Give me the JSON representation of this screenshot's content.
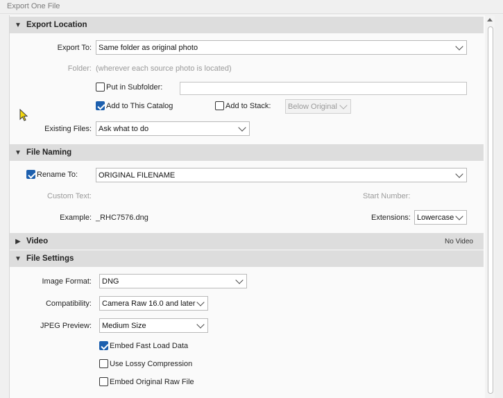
{
  "window": {
    "title": "Export One File"
  },
  "sections": {
    "export_location": {
      "title": "Export Location",
      "export_to_label": "Export To:",
      "export_to_value": "Same folder as original photo",
      "folder_label": "Folder:",
      "folder_value": "(wherever each source photo is located)",
      "subfolder_label": "Put in Subfolder:",
      "subfolder_checked": false,
      "subfolder_value": "",
      "add_catalog_label": "Add to This Catalog",
      "add_catalog_checked": true,
      "add_stack_label": "Add to Stack:",
      "add_stack_checked": false,
      "stack_position_value": "Below Original",
      "existing_files_label": "Existing Files:",
      "existing_files_value": "Ask what to do"
    },
    "file_naming": {
      "title": "File Naming",
      "rename_label": "Rename To:",
      "rename_checked": true,
      "rename_value": "ORIGINAL FILENAME",
      "custom_text_label": "Custom Text:",
      "start_number_label": "Start Number:",
      "example_label": "Example:",
      "example_value": "_RHC7576.dng",
      "extensions_label": "Extensions:",
      "extensions_value": "Lowercase"
    },
    "video": {
      "title": "Video",
      "note": "No Video"
    },
    "file_settings": {
      "title": "File Settings",
      "image_format_label": "Image Format:",
      "image_format_value": "DNG",
      "compatibility_label": "Compatibility:",
      "compatibility_value": "Camera Raw 16.0 and later",
      "jpeg_preview_label": "JPEG Preview:",
      "jpeg_preview_value": "Medium Size",
      "embed_fast_load_label": "Embed Fast Load Data",
      "embed_fast_load_checked": true,
      "lossy_label": "Use Lossy Compression",
      "lossy_checked": false,
      "embed_raw_label": "Embed Original Raw File",
      "embed_raw_checked": false
    }
  },
  "colors": {
    "check_accent": "#1c5fae",
    "header_bg": "#dddddd"
  }
}
